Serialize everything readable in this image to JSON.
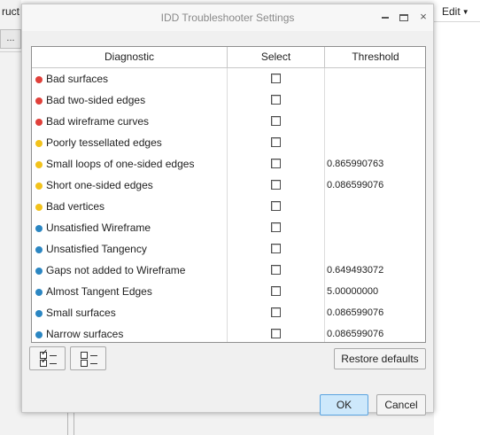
{
  "background": {
    "left_fragment_text": "ruct",
    "left_fragment_button": "...",
    "right_menu_label": "Edit",
    "right_menu_caret": "▼"
  },
  "dialog": {
    "title": "IDD Troubleshooter Settings",
    "controls": {
      "minimize": "minimize-icon",
      "maximize": "maximize-icon",
      "close": "×"
    }
  },
  "table": {
    "columns": [
      "Diagnostic",
      "Select",
      "Threshold"
    ],
    "status_colors": {
      "red": "#e0403a",
      "yellow": "#f2c21b",
      "blue": "#2b86c2"
    },
    "rows": [
      {
        "label": "Bad surfaces",
        "status": "red",
        "selected": false,
        "threshold": ""
      },
      {
        "label": "Bad two-sided edges",
        "status": "red",
        "selected": false,
        "threshold": ""
      },
      {
        "label": "Bad wireframe curves",
        "status": "red",
        "selected": false,
        "threshold": ""
      },
      {
        "label": "Poorly tessellated edges",
        "status": "yellow",
        "selected": false,
        "threshold": ""
      },
      {
        "label": "Small loops of one-sided edges",
        "status": "yellow",
        "selected": false,
        "threshold": "0.865990763"
      },
      {
        "label": "Short one-sided edges",
        "status": "yellow",
        "selected": false,
        "threshold": "0.086599076"
      },
      {
        "label": "Bad vertices",
        "status": "yellow",
        "selected": false,
        "threshold": ""
      },
      {
        "label": "Unsatisfied Wireframe",
        "status": "blue",
        "selected": false,
        "threshold": ""
      },
      {
        "label": "Unsatisfied Tangency",
        "status": "blue",
        "selected": false,
        "threshold": ""
      },
      {
        "label": "Gaps not added to Wireframe",
        "status": "blue",
        "selected": false,
        "threshold": "0.649493072"
      },
      {
        "label": "Almost Tangent Edges",
        "status": "blue",
        "selected": false,
        "threshold": "5.00000000"
      },
      {
        "label": "Small surfaces",
        "status": "blue",
        "selected": false,
        "threshold": "0.086599076"
      },
      {
        "label": "Narrow surfaces",
        "status": "blue",
        "selected": false,
        "threshold": "0.086599076"
      }
    ]
  },
  "buttons": {
    "select_all": "select-all-icon",
    "deselect_all": "deselect-all-icon",
    "restore_defaults": "Restore defaults",
    "ok": "OK",
    "cancel": "Cancel"
  }
}
